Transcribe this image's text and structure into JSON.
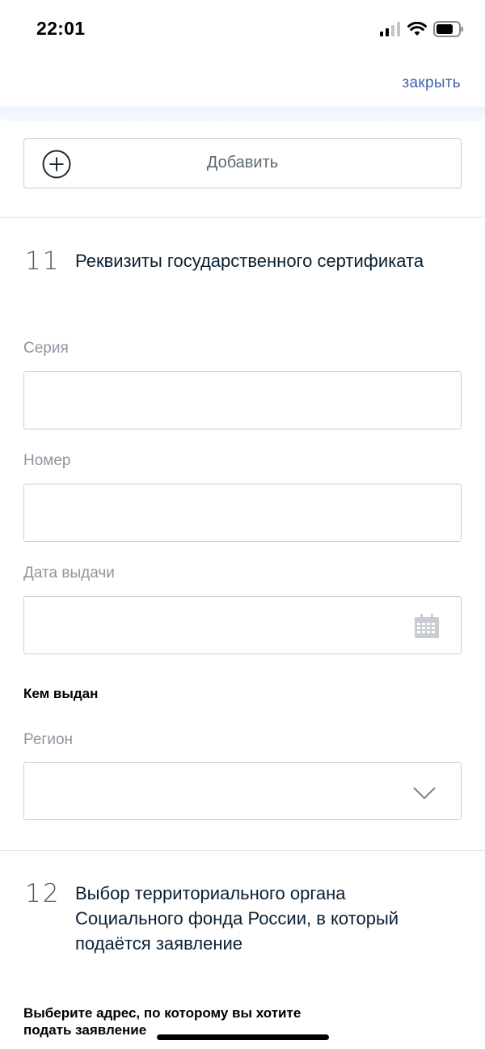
{
  "status_bar": {
    "time": "22:01"
  },
  "header": {
    "close_label": "закрыть",
    "accent_color": "#3f62b3"
  },
  "add_button": {
    "label": "Добавить",
    "icon": "plus-circle-icon"
  },
  "section_11": {
    "number": "11",
    "title": "Реквизиты государственного сертификата",
    "fields": {
      "series": {
        "label": "Серия",
        "value": ""
      },
      "number": {
        "label": "Номер",
        "value": ""
      },
      "issue_date": {
        "label": "Дата выдачи",
        "value": "",
        "icon": "calendar-icon"
      }
    },
    "issued_by": {
      "heading": "Кем выдан",
      "region": {
        "label": "Регион",
        "value": "",
        "icon": "chevron-down-icon"
      }
    }
  },
  "section_12": {
    "number": "12",
    "title": "Выбор территориального органа Социального фонда России, в который подаётся заявление",
    "address_prompt": "Выберите адрес, по которому вы хотите подать заявление"
  }
}
